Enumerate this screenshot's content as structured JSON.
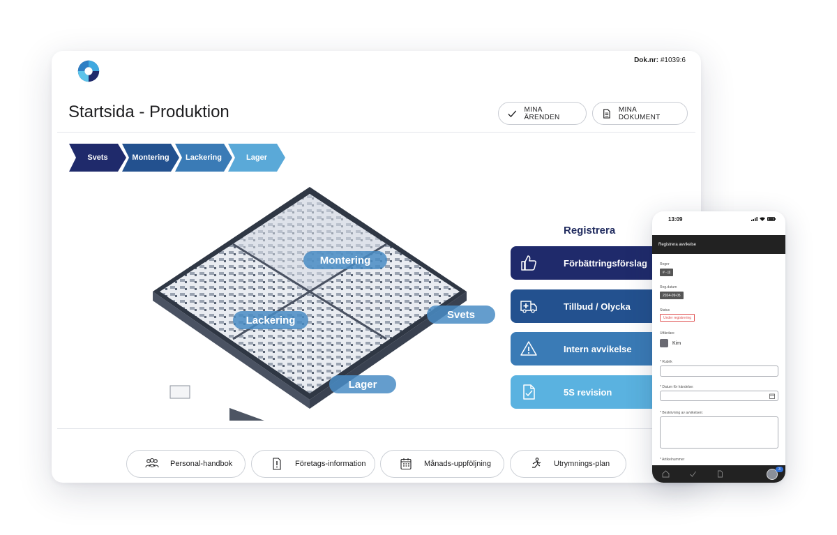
{
  "doc": {
    "label": "Dok.nr:",
    "value": "#1039:6"
  },
  "title": "Startsida - Produktion",
  "top_buttons": {
    "arenden": "MINA ÄRENDEN",
    "dokument": "MINA DOKUMENT"
  },
  "chevrons": [
    {
      "label": "Svets",
      "color": "#1f2a6b"
    },
    {
      "label": "Montering",
      "color": "#23518f"
    },
    {
      "label": "Lackering",
      "color": "#3a7bb6"
    },
    {
      "label": "Lager",
      "color": "#5aa9d8"
    }
  ],
  "factory_labels": {
    "montering": "Montering",
    "lackering": "Lackering",
    "svets": "Svets",
    "lager": "Lager"
  },
  "register": {
    "title": "Registrera",
    "buttons": [
      {
        "label": "Förbättringsförslag",
        "icon": "thumbs-up-icon",
        "color": "#1f2a6b"
      },
      {
        "label": "Tillbud / Olycka",
        "icon": "ambulance-icon",
        "color": "#23518f"
      },
      {
        "label": "Intern avvikelse",
        "icon": "warning-icon",
        "color": "#3a7bb6"
      },
      {
        "label": "5S revision",
        "icon": "document-check-icon",
        "color": "#5ab2e0"
      }
    ]
  },
  "bottom_buttons": [
    {
      "label": "Personal-handbok",
      "icon": "people-icon"
    },
    {
      "label": "Företags-information",
      "icon": "info-document-icon"
    },
    {
      "label": "Månads-uppföljning",
      "icon": "calendar-icon"
    },
    {
      "label": "Utrymnings-plan",
      "icon": "running-person-icon"
    }
  ],
  "phone": {
    "time": "13:09",
    "header": "Registrera avvikelse",
    "regnr_label": "Regnr",
    "regnr_value": "#  -  ||\\",
    "regdatum_label": "Reg.datum",
    "regdatum_value": "2024-09-05",
    "status_label": "Status",
    "status_value": "Under registrering",
    "utfardare_label": "Utfärdare",
    "utfardare_value": "Kim",
    "rubrik_label": "* Rubrik",
    "datum_label": "* Datum för händelse:",
    "beskrivning_label": "* Beskrivning av avvikelsen:",
    "artikel_label": "* Artikelnummer",
    "badge": "3"
  }
}
